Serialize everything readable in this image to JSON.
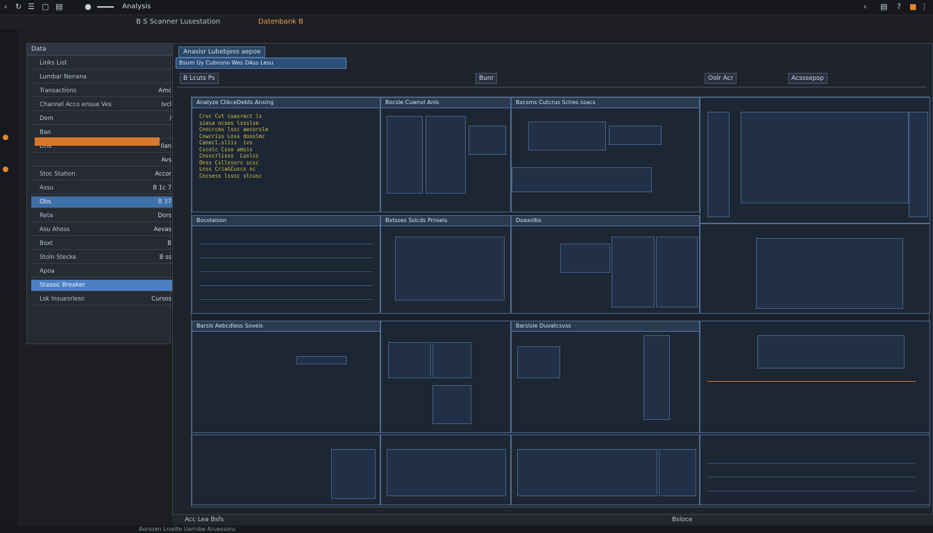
{
  "window": {
    "title": "Analysis",
    "menu_glyphs": [
      "‹",
      "▢",
      "≡"
    ]
  },
  "breadcrumb": {
    "left": "B  S  Scanner  Lusestation",
    "right": "Datenbank  B"
  },
  "sidebar": {
    "title": "Data",
    "items": [
      {
        "label": "Links  List",
        "value": ""
      },
      {
        "label": "Lumbar Nenana",
        "value": ""
      },
      {
        "label": "Transactions",
        "value": "Amc"
      },
      {
        "label": "Channel Acco  ensue  Ves",
        "value": "Ivcl"
      },
      {
        "label": "Dem",
        "value": "/"
      },
      {
        "label": "Ban",
        "value": ""
      },
      {
        "label": "Line",
        "value": "Ilan"
      },
      {
        "label": "",
        "value": "Avs"
      },
      {
        "label": "Stoc Station",
        "value": "Accor"
      },
      {
        "label": "Assu",
        "value": "B 1c 7"
      },
      {
        "label": "Obs",
        "value": "B 37"
      },
      {
        "label": "Reta",
        "value": "Dors"
      },
      {
        "label": "Asu  Ahoss",
        "value": "Aevas"
      },
      {
        "label": "Boxt",
        "value": "B"
      },
      {
        "label": "Stoln Stecke",
        "value": "B ss"
      },
      {
        "label": "Apoa",
        "value": ""
      },
      {
        "label": "Stassic Breaker",
        "value": ""
      },
      {
        "label": "Lsk  Insuesrlesn",
        "value": "Cursos"
      }
    ]
  },
  "main": {
    "tab_label": "Anasisr  Lubebjess aepoe",
    "address": "Bsum  Uy  Cubnsno  Wes  DAss  Lesu",
    "toolbar": {
      "label1": "B  Lcuts  Ps",
      "label2": "Bunr",
      "label3": "Oolr  Acr",
      "label4": "Acsssepsp"
    },
    "panels": [
      {
        "title": "Analyze  ClikceDebts  Ansing",
        "code": "Crvc Cvt cuesrect ls\nsiesa ncses lssslse\nCnncrces lssc aecorsle\nCnwcriss Loss dooslmc\nCanecl.sliis  ivs\nCvcolc Csso amsis\nCnsscrlisss  Luslss\nOnss Csllsssrc scsc\nLnss CriaGCuscs sc\nCncsess lsssc stcusc"
      },
      {
        "title": "Bocsle Cuwnvl Anls",
        "code": ""
      },
      {
        "title": "Bxcsms  Cutcrus Sclres ssacs",
        "code": ""
      },
      {
        "title": "Bocolalson",
        "code": ""
      },
      {
        "title": "Bxtsses  Sslcds  Prnsels",
        "code": ""
      },
      {
        "title": "Doaxolbs",
        "code": ""
      },
      {
        "title": "Barsls  Aebcdless  Soveis",
        "code": ""
      },
      {
        "title": "Barslsle  Duvatcsvss",
        "code": ""
      }
    ]
  },
  "status": {
    "left": "Acc  Lea  Bsfs",
    "right": "Bsloce"
  },
  "bottom": {
    "text": "Aorsoen  Lrselte  Uarnibe  Aruessons"
  },
  "colors": {
    "accent": "#d8782a",
    "code": "#d6c24d",
    "panel_border": "#4f6e94",
    "selection": "#4a7fc2"
  }
}
